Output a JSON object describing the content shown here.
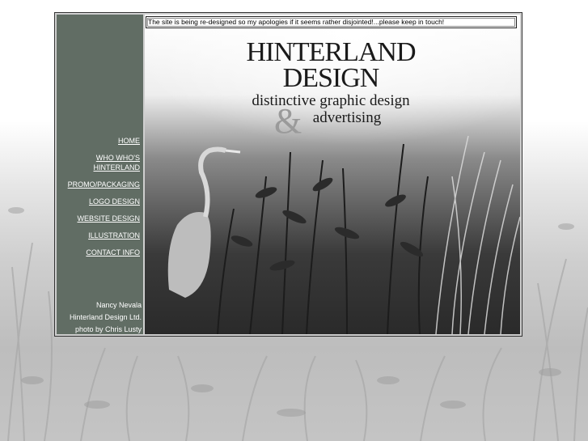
{
  "notice": "The site is being re-designed so my apologies if it seems rather disjointed!...please keep in touch!",
  "nav": [
    {
      "label": "HOME"
    },
    {
      "label": "WHO WHO'S HINTERLAND"
    },
    {
      "label": "PROMO/PACKAGING"
    },
    {
      "label": "LOGO DESIGN"
    },
    {
      "label": "WEBSITE DESIGN"
    },
    {
      "label": "ILLUSTRATION"
    },
    {
      "label": "CONTACT INFO"
    }
  ],
  "credits": {
    "line1": "Nancy Nevala",
    "line2": "Hinterland Design Ltd.",
    "line3": "photo by Chris Lusty"
  },
  "logo": {
    "line1": "HINTERLAND",
    "line2": "DESIGN",
    "line3": "distinctive graphic design",
    "ampersand": "&",
    "line4": "advertising"
  },
  "colors": {
    "sidebar": "#616d64",
    "frame_border": "#333333"
  }
}
